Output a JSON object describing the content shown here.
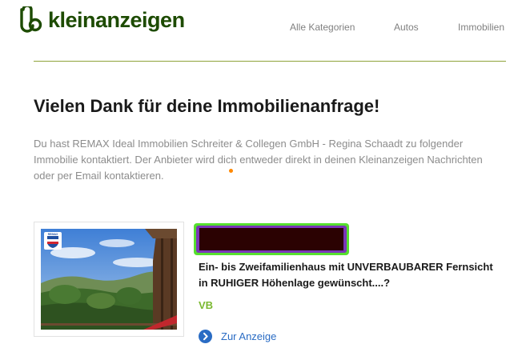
{
  "header": {
    "logo_text": "kleinanzeigen",
    "nav": [
      "Alle Kategorien",
      "Autos",
      "Immobilien"
    ]
  },
  "main": {
    "title": "Vielen Dank für deine Immobilienanfrage!",
    "description": "Du hast REMAX Ideal Immobilien Schreiter & Collegen GmbH - Regina Schaadt zu folgender Immobilie kontaktiert. Der Anbieter wird dich entweder direkt in deinen Kleinanzeigen Nachrichten oder per Email kontaktieren."
  },
  "listing": {
    "image_badge": "RE/MAX",
    "title": "Ein- bis Zweifamilienhaus mit UNVERBAUBARER Fernsicht in RUHIGER Höhenlage gewünscht....?",
    "price": "VB",
    "link_label": "Zur Anzeige"
  },
  "colors": {
    "brand": "#1d4b00",
    "accent_green": "#7ab830",
    "link_blue": "#2a6cc4",
    "divider": "#8fa33a"
  }
}
